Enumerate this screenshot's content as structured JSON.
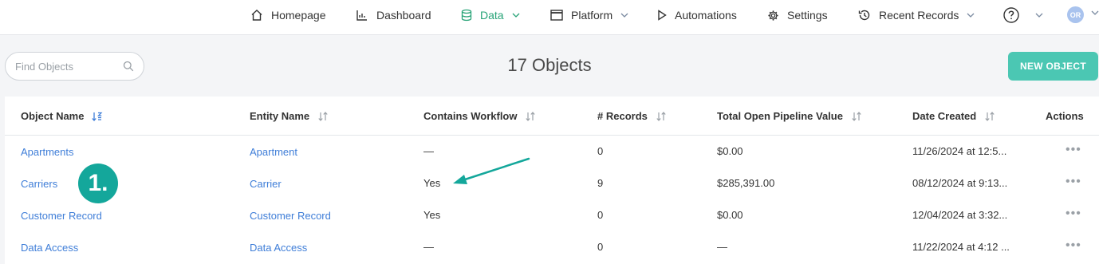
{
  "nav": {
    "items": [
      {
        "label": "Homepage",
        "icon": "home-icon"
      },
      {
        "label": "Dashboard",
        "icon": "chart-icon"
      },
      {
        "label": "Data",
        "icon": "database-icon",
        "active": true,
        "dropdown": true
      },
      {
        "label": "Platform",
        "icon": "window-icon",
        "dropdown": true
      },
      {
        "label": "Automations",
        "icon": "play-icon"
      },
      {
        "label": "Settings",
        "icon": "gear-icon"
      },
      {
        "label": "Recent Records",
        "icon": "history-icon",
        "dropdown": true
      }
    ],
    "help_icon": "help-icon",
    "avatar_initials": "OR"
  },
  "toolbar": {
    "search_placeholder": "Find Objects",
    "title": "17 Objects",
    "new_button": "NEW OBJECT"
  },
  "table": {
    "columns": [
      "Object Name",
      "Entity Name",
      "Contains Workflow",
      "# Records",
      "Total Open Pipeline Value",
      "Date Created",
      "Actions"
    ],
    "rows": [
      {
        "object": "Apartments",
        "entity": "Apartment",
        "workflow": "—",
        "records": "0",
        "pipeline": "$0.00",
        "date": "11/26/2024 at 12:5..."
      },
      {
        "object": "Carriers",
        "entity": "Carrier",
        "workflow": "Yes",
        "records": "9",
        "pipeline": "$285,391.00",
        "date": "08/12/2024 at 9:13..."
      },
      {
        "object": "Customer Record",
        "entity": "Customer Record",
        "workflow": "Yes",
        "records": "0",
        "pipeline": "$0.00",
        "date": "12/04/2024 at 3:32..."
      },
      {
        "object": "Data Access",
        "entity": "Data Access",
        "workflow": "—",
        "records": "0",
        "pipeline": "—",
        "date": "11/22/2024 at 4:12 ..."
      }
    ],
    "actions_glyph": "•••"
  },
  "annotation": {
    "badge": "1."
  },
  "colors": {
    "accent_green": "#27a377",
    "button_teal": "#4bc7b3",
    "link_blue": "#3f7ed8",
    "annotation_teal": "#14a79b"
  }
}
